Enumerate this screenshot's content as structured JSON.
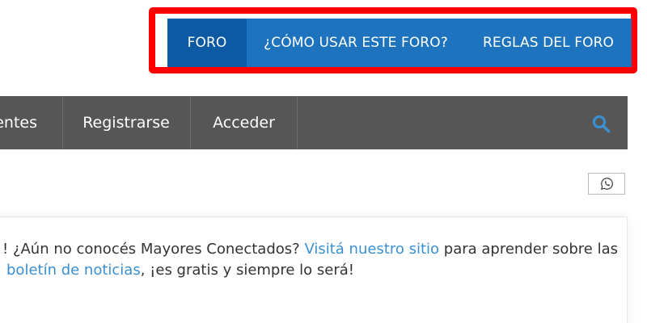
{
  "top_nav": {
    "items": [
      {
        "label": "FORO",
        "active": true
      },
      {
        "label": "¿CÓMO USAR ESTE FORO?"
      },
      {
        "label": "REGLAS DEL FORO"
      }
    ]
  },
  "main_nav": {
    "items": [
      {
        "label": "entes"
      },
      {
        "label": "Registrarse"
      },
      {
        "label": "Acceder"
      }
    ],
    "search_icon": "search-icon"
  },
  "share": {
    "icon": "whatsapp-icon"
  },
  "notice": {
    "line1_prefix": "! ¿Aún no conocés Mayores Conectados? ",
    "line1_link": "Visitá nuestro sitio",
    "line1_suffix": " para aprender sobre las",
    "line2_link": "boletín de noticias",
    "line2_suffix": ", ¡es gratis y siempre lo será!"
  },
  "colors": {
    "highlight_border": "#ff0000",
    "top_nav_bg": "#1e73be",
    "top_nav_active_bg": "#0b5aa3",
    "main_nav_bg": "#565656",
    "link": "#3a8fd0",
    "search_icon": "#3a8fd0"
  }
}
